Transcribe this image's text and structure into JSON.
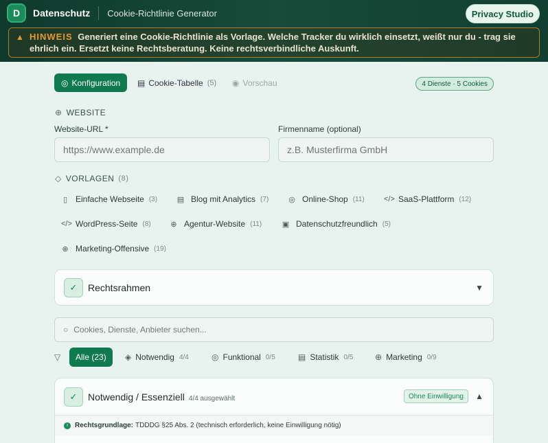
{
  "app": {
    "logo_letter": "D",
    "brand": "Datenschutz",
    "subtitle": "Cookie-Richtlinie Generator",
    "studio_button": "Privacy Studio"
  },
  "notice": {
    "label": "HINWEIS",
    "text": "Generiert eine Cookie-Richtlinie als Vorlage. Welche Tracker du wirklich einsetzt, weißt nur du - trag sie ehrlich ein. Ersetzt keine Rechtsberatung. Keine rechtsverbindliche Auskunft."
  },
  "tabs": [
    {
      "label": "Konfiguration",
      "icon": "cookie-icon"
    },
    {
      "label": "Cookie-Tabelle",
      "count": "(5)",
      "icon": "table-icon"
    },
    {
      "label": "Vorschau",
      "icon": "eye-icon"
    }
  ],
  "summary_badge": "4 Dienste · 5 Cookies",
  "website": {
    "heading": "WEBSITE",
    "url_label": "Website-URL *",
    "url_placeholder": "https://www.example.de",
    "company_label": "Firmenname (optional)",
    "company_placeholder": "z.B. Musterfirma GmbH"
  },
  "templates": {
    "heading": "VORLAGEN",
    "count": "(8)",
    "items": [
      {
        "label": "Einfache Webseite",
        "count": "(3)",
        "icon": "document-icon"
      },
      {
        "label": "Blog mit Analytics",
        "count": "(7)",
        "icon": "table-icon"
      },
      {
        "label": "Online-Shop",
        "count": "(11)",
        "icon": "cookie-icon"
      },
      {
        "label": "SaaS-Plattform",
        "count": "(12)",
        "icon": "code-icon"
      },
      {
        "label": "WordPress-Seite",
        "count": "(8)",
        "icon": "code-icon"
      },
      {
        "label": "Agentur-Website",
        "count": "(11)",
        "icon": "globe-icon"
      },
      {
        "label": "Datenschutzfreundlich",
        "count": "(5)",
        "icon": "lock-icon"
      },
      {
        "label": "Marketing-Offensive",
        "count": "(19)",
        "icon": "globe-icon"
      }
    ]
  },
  "legal_frame": {
    "title": "Rechtsrahmen"
  },
  "search": {
    "placeholder": "Cookies, Dienste, Anbieter suchen..."
  },
  "filters": [
    {
      "label": "Alle (23)"
    },
    {
      "label": "Notwendig",
      "count": "4/4",
      "icon": "shield-icon"
    },
    {
      "label": "Funktional",
      "count": "0/5",
      "icon": "cookie-icon"
    },
    {
      "label": "Statistik",
      "count": "0/5",
      "icon": "table-icon"
    },
    {
      "label": "Marketing",
      "count": "0/9",
      "icon": "globe-icon"
    }
  ],
  "category": {
    "title": "Notwendig / Essenziell",
    "selected": "4/4 ausgewählt",
    "badge": "Ohne Einwilligung",
    "legal_label": "Rechtsgrundlage:",
    "legal_text": "TDDDG §25 Abs. 2 (technisch erforderlich, keine Einwilligung nötig)"
  },
  "colors": {
    "accent": "#0f7a50",
    "header": "#123f31",
    "warning": "#e89a2b"
  }
}
